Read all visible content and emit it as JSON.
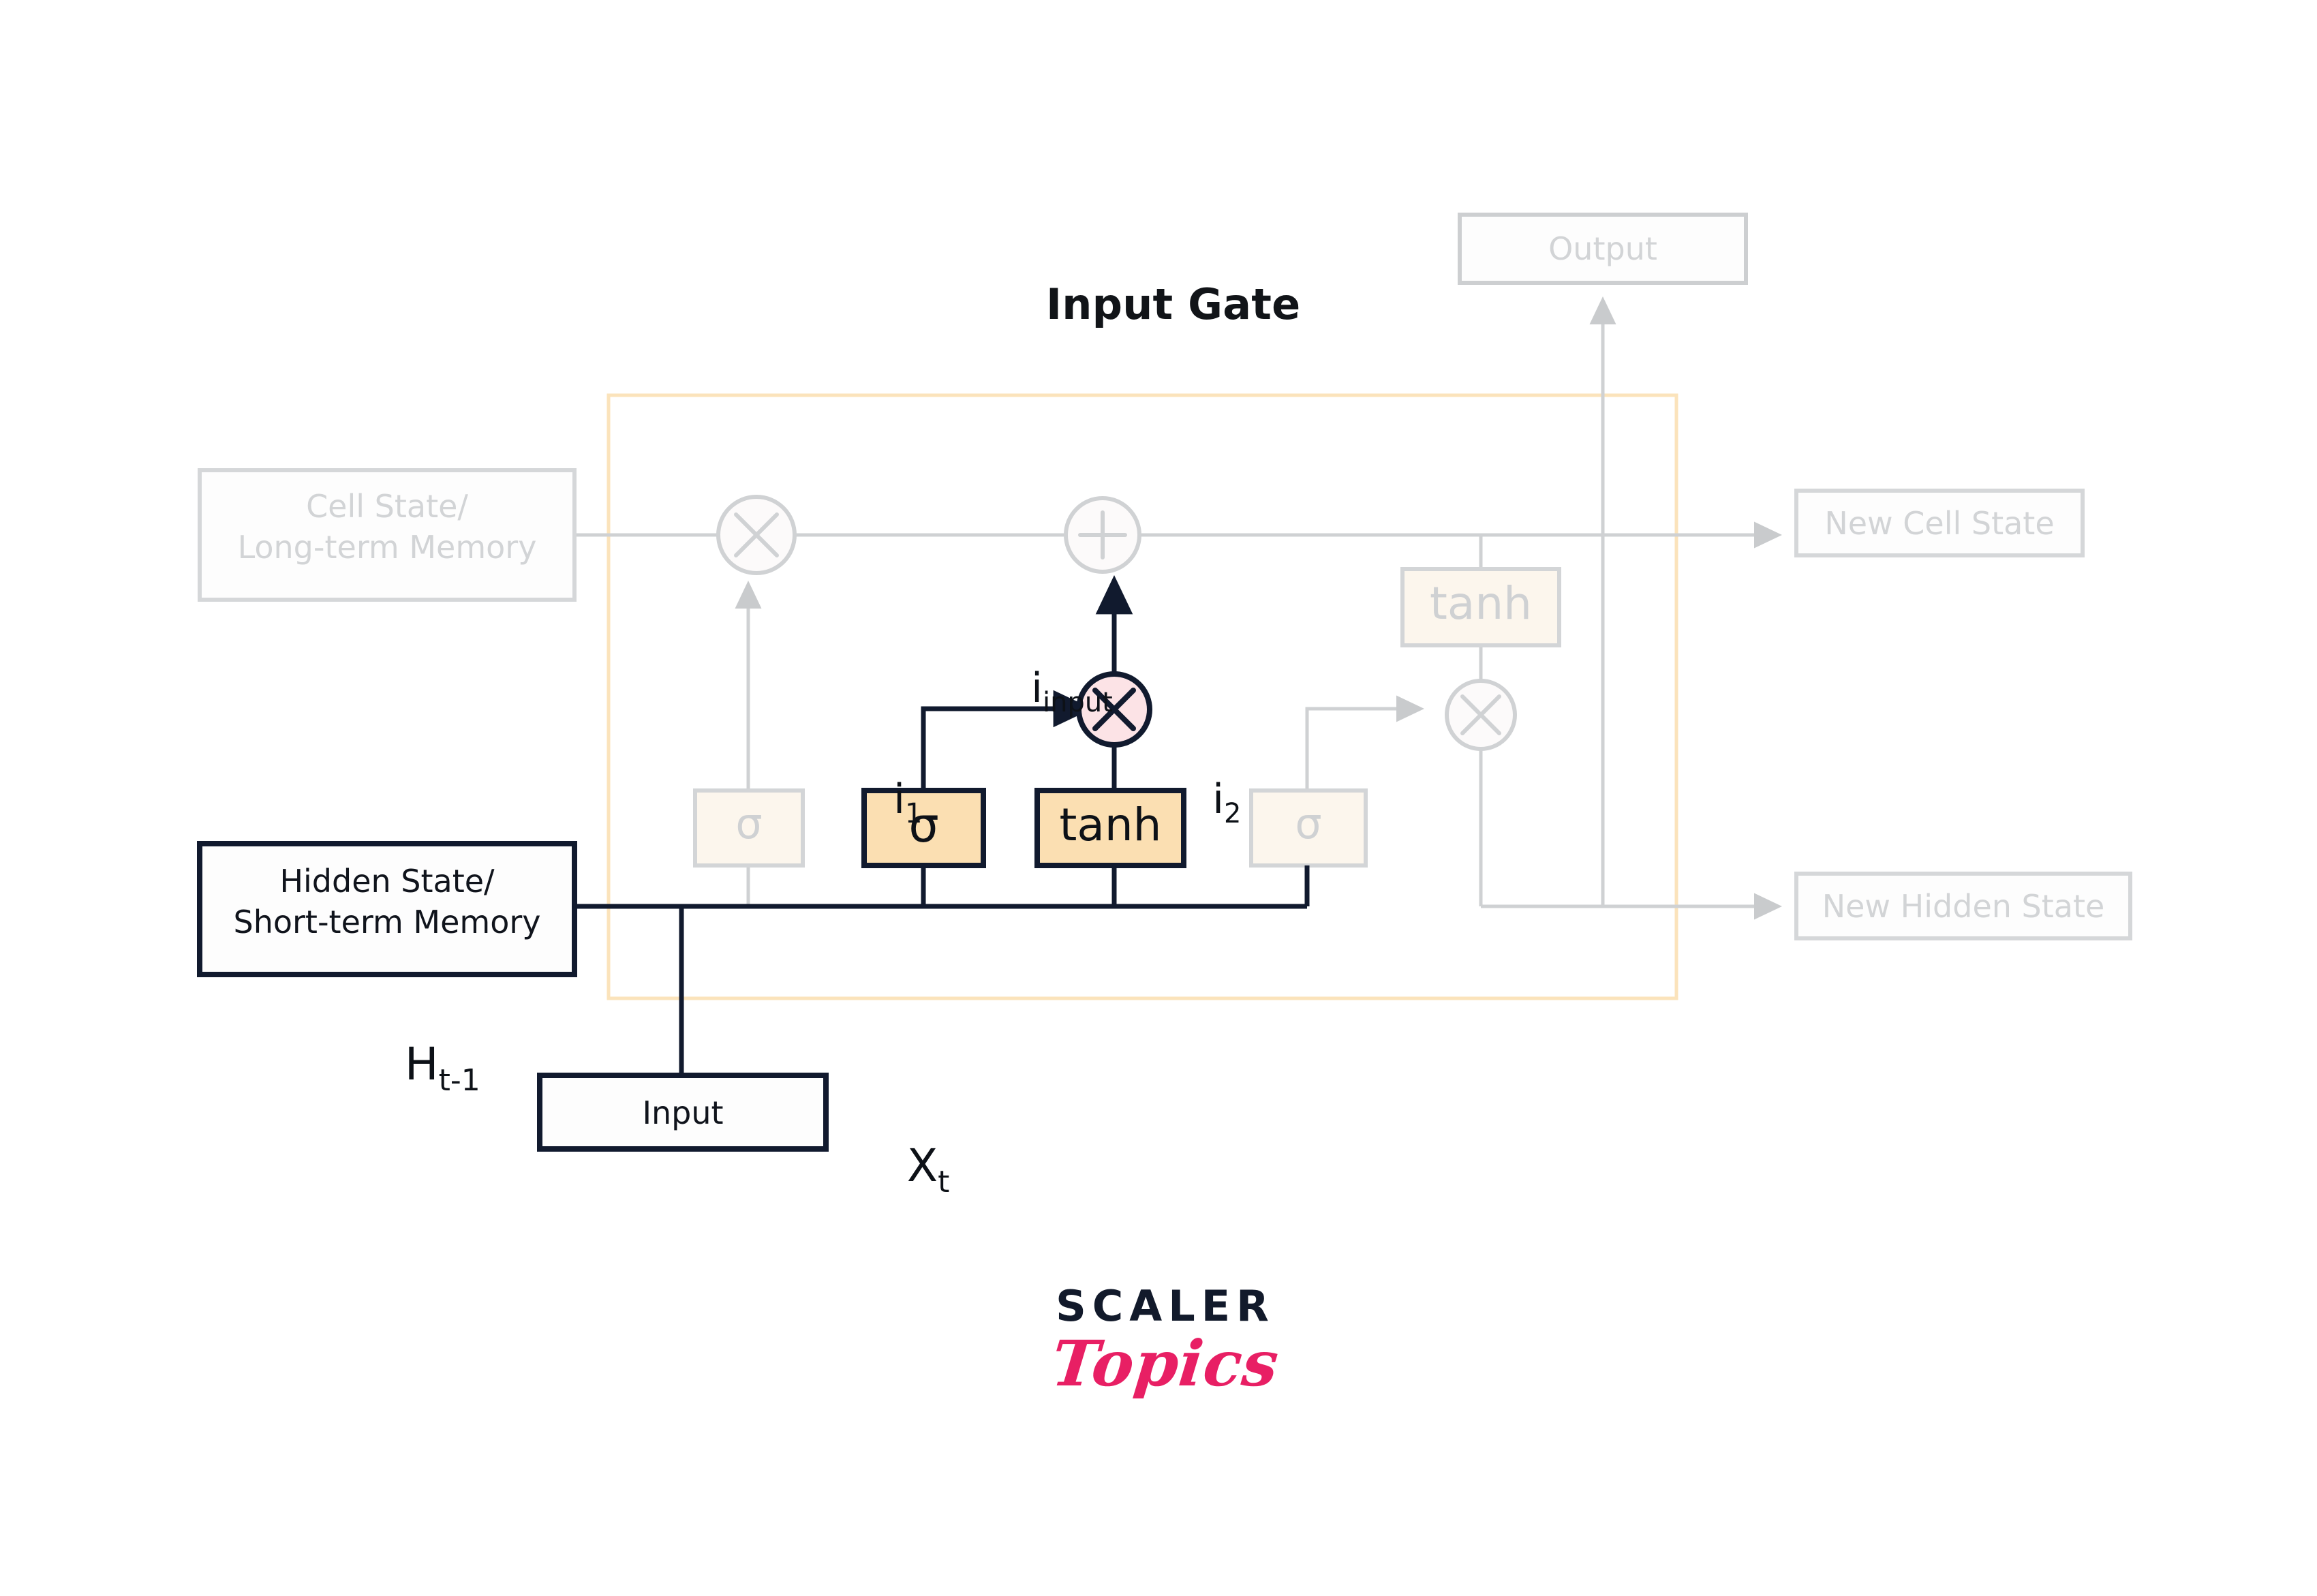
{
  "page": {
    "title": "Input Gate",
    "background": "#ffffff"
  },
  "colors": {
    "dark_stroke": "#111a2e",
    "dim_stroke": "#cfd1d3",
    "orange_fill": "#fbdfb2",
    "orange_fill_dim": "#fcf5eb",
    "pink_fill": "#fce3e6",
    "container_border": "#fbe3bb",
    "dim_text": "#d0d2d4",
    "dark_text": "#10141c",
    "logo_navy": "#121a2b",
    "logo_pink": "#e81f64"
  },
  "diagram": {
    "type": "lstm-cell",
    "highlight_region_label": "Input Gate",
    "nodes": [
      {
        "id": "cell-state-in",
        "label": "Cell State/\nLong-term Memory",
        "line1": "Cell State/",
        "line2": "Long-term Memory",
        "state": "dim",
        "shape": "rect"
      },
      {
        "id": "hidden-state-in",
        "label": "Hidden State/\nShort-term Memory",
        "line1": "Hidden State/",
        "line2": "Short-term Memory",
        "state": "active",
        "shape": "rect"
      },
      {
        "id": "input",
        "label": "Input",
        "state": "active",
        "shape": "rect"
      },
      {
        "id": "output",
        "label": "Output",
        "state": "dim",
        "shape": "rect"
      },
      {
        "id": "new-cell-state",
        "label": "New Cell State",
        "state": "dim",
        "shape": "rect"
      },
      {
        "id": "new-hidden-state",
        "label": "New Hidden State",
        "state": "dim",
        "shape": "rect"
      },
      {
        "id": "forget-sigmoid",
        "label": "σ",
        "state": "dim",
        "shape": "rect-fn"
      },
      {
        "id": "input-sigmoid",
        "label": "σ",
        "state": "active",
        "shape": "rect-fn"
      },
      {
        "id": "candidate-tanh",
        "label": "tanh",
        "state": "active",
        "shape": "rect-fn"
      },
      {
        "id": "output-sigmoid",
        "label": "σ",
        "state": "dim",
        "shape": "rect-fn"
      },
      {
        "id": "cell-tanh",
        "label": "tanh",
        "state": "dim",
        "shape": "rect-fn"
      },
      {
        "id": "forget-multiply",
        "label": "✕",
        "state": "dim",
        "shape": "circle-op"
      },
      {
        "id": "cell-add",
        "label": "＋",
        "state": "dim",
        "shape": "circle-op"
      },
      {
        "id": "input-multiply",
        "label": "✕",
        "state": "active",
        "shape": "circle-op"
      },
      {
        "id": "output-multiply",
        "label": "✕",
        "state": "dim",
        "shape": "circle-op"
      }
    ],
    "math_labels": [
      {
        "id": "i-input",
        "base": "i",
        "sub": "input",
        "state": "active"
      },
      {
        "id": "i-one",
        "base": "i",
        "sub": "1",
        "state": "active"
      },
      {
        "id": "i-two",
        "base": "i",
        "sub": "2",
        "state": "active"
      },
      {
        "id": "h-prev",
        "base": "H",
        "sub": "t-1",
        "state": "active"
      },
      {
        "id": "x-t",
        "base": "X",
        "sub": "t",
        "state": "active"
      }
    ]
  },
  "logo": {
    "primary": "SCALER",
    "secondary": "Topics"
  }
}
